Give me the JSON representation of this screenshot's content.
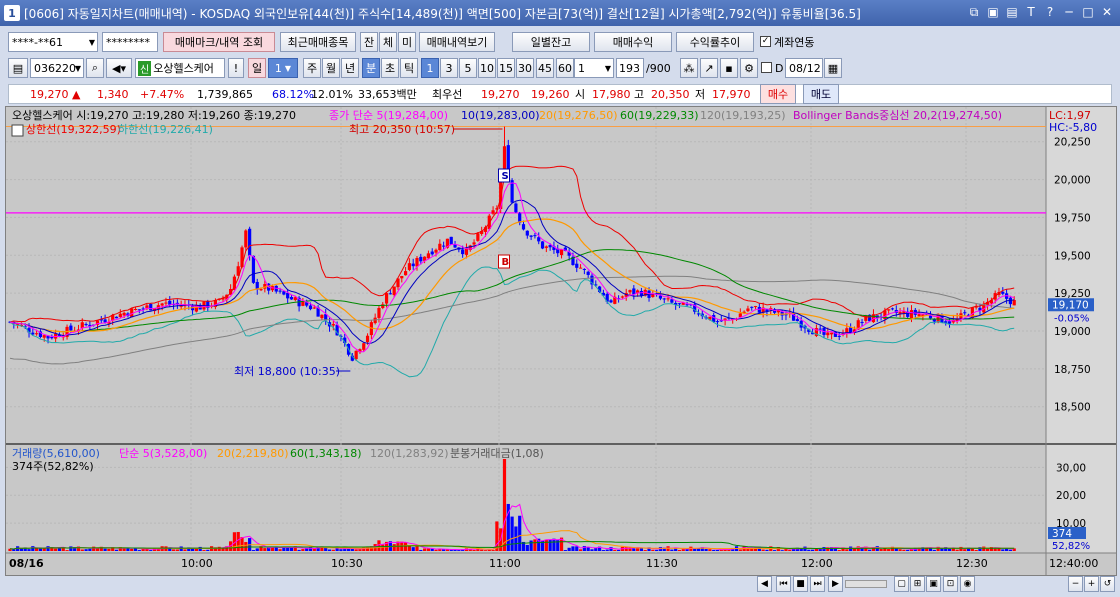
{
  "window": {
    "title": "[0606] 자동일지차트(매매내역) - KOSDAQ 외국인보유[44(천)] 주식수[14,489(천)] 액면[500] 자본금[73(억)] 결산[12월] 시가총액[2,792(억)] 유통비율[36.5]",
    "app_icon": "1"
  },
  "toolbar1": {
    "account": "****-**61",
    "password": "********",
    "mark_button": "매매마크/내역 조회",
    "recent_button": "최근매매종목",
    "jan": "잔",
    "che": "체",
    "mi": "미",
    "view_button": "매매내역보기",
    "daily_button": "일별잔고",
    "monthly_button": "매매수익",
    "return_button": "수익률추이",
    "account_link_label": "계좌연동"
  },
  "toolbar2": {
    "code": "036220",
    "name_badge": "신",
    "name": "오상헬스케어",
    "period_day": "일",
    "period_num": "1",
    "week": "주",
    "month": "월",
    "year": "년",
    "minute": "분",
    "second": "초",
    "tick": "틱",
    "intervals": [
      "1",
      "3",
      "5",
      "10",
      "15",
      "30",
      "45",
      "60"
    ],
    "custom_interval": "1",
    "count": "193",
    "count_total": "/900",
    "date_checkbox": "D",
    "date": "08/12"
  },
  "quote": {
    "price": "19,270",
    "arrow": "▲",
    "change": "1,340",
    "change_pct": "+7.47%",
    "volume": "1,739,865",
    "vol_ratio": "68.12%",
    "turnover": "12.01%",
    "amount": "33,653백만",
    "best_bid_label": "최우선",
    "best_ask": "19,270",
    "best_bid": "19,260",
    "open_label": "시",
    "open": "17,980",
    "high_label": "고",
    "high": "20,350",
    "low_label": "저",
    "low": "17,970",
    "buy_button": "매수",
    "sell_button": "매도"
  },
  "legend": {
    "stock": "오상헬스케어 시:19,270 고:19,280 저:19,260 종:19,270",
    "ma5": "종가 단순 5(19,284,00)",
    "ma10": "10(19,283,00)",
    "ma20": "20(19,276,50)",
    "ma60": "60(19,229,33)",
    "ma120": "120(19,193,25)",
    "bb": "Bollinger Bands중심선 20,2(19,274,50)",
    "upper": "상한선(19,322,59)",
    "lower": "하한선(19,226,41)",
    "lc": "LC:1,97",
    "hc": "HC:-5,80",
    "high_note": "최고 20,350 (10:57)",
    "low_note": "최저 18,800 (10:35)",
    "sell_marker": "S",
    "buy_marker": "B"
  },
  "price_axis": {
    "labels": [
      "20,250",
      "20,000",
      "19,750",
      "19,500",
      "19,250",
      "19,000",
      "18,750",
      "18,500"
    ],
    "current": "19,170",
    "current_pct": "-0.05%"
  },
  "volume_legend": {
    "vol": "거래량(5,610,00)",
    "v5": "단순 5(3,528,00)",
    "v20": "20(2,219,80)",
    "v60": "60(1,343,18)",
    "v120": "120(1,283,92)",
    "vamt": "분봉거래대금(1,08)",
    "sub": "374주(52,82%)"
  },
  "volume_axis": {
    "labels": [
      "30,00",
      "20,00",
      "10,00"
    ],
    "current": "374",
    "current_pct": "52,82%"
  },
  "time_axis": {
    "date": "08/16",
    "labels": [
      "10:00",
      "10:30",
      "11:00",
      "11:30",
      "12:00",
      "12:30",
      "12:40:00"
    ]
  },
  "colors": {
    "up": "#ff0000",
    "down": "#0000ff",
    "ma5": "#ff00ff",
    "ma10": "#0000c0",
    "ma20": "#ff9900",
    "ma60": "#008800",
    "ma120": "#808080",
    "bb_upper": "#ee0000",
    "bb_lower": "#22aaaa",
    "hline": "#ff00ff"
  },
  "chart_data": {
    "type": "candlestick",
    "y_range": [
      18300,
      20400
    ],
    "key_levels": {
      "high": 20350,
      "low": 18800,
      "last": 19170,
      "ref_line": 19780
    }
  }
}
